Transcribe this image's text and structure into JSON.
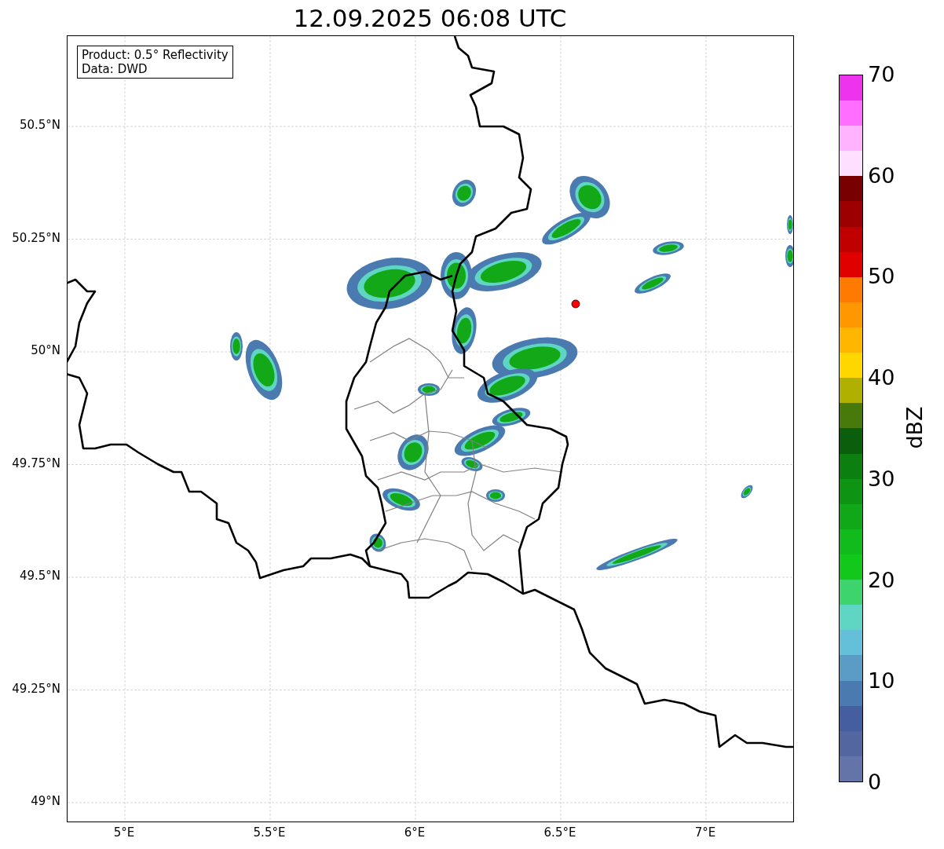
{
  "title": "12.09.2025 06:08 UTC",
  "info_box": [
    "Product: 0.5° Reflectivity",
    "Data: DWD"
  ],
  "map": {
    "lat_labels": [
      "50.5°N",
      "50.25°N",
      "50°N",
      "49.75°N",
      "49.5°N",
      "49.25°N",
      "49°N"
    ],
    "lon_labels": [
      "5°E",
      "5.5°E",
      "6°E",
      "6.5°E",
      "7°E"
    ]
  },
  "colorbar": {
    "label": "dBZ",
    "ticks": [
      "70",
      "60",
      "50",
      "40",
      "30",
      "20",
      "10",
      "0"
    ],
    "bands": [
      {
        "color": "#6574a8"
      },
      {
        "color": "#5466a0"
      },
      {
        "color": "#445ea0"
      },
      {
        "color": "#4a7ab0"
      },
      {
        "color": "#5a9cc6"
      },
      {
        "color": "#64c0d9"
      },
      {
        "color": "#5fd6c3"
      },
      {
        "color": "#3dd46e"
      },
      {
        "color": "#12c81a"
      },
      {
        "color": "#12bb1c"
      },
      {
        "color": "#10a818"
      },
      {
        "color": "#0e9313"
      },
      {
        "color": "#0c7f11"
      },
      {
        "color": "#0a5e0c"
      },
      {
        "color": "#477a0a"
      },
      {
        "color": "#afb000"
      },
      {
        "color": "#ffd700"
      },
      {
        "color": "#ffb600"
      },
      {
        "color": "#ff9800"
      },
      {
        "color": "#ff7a00"
      },
      {
        "color": "#e00000"
      },
      {
        "color": "#c00000"
      },
      {
        "color": "#9c0000"
      },
      {
        "color": "#780000"
      },
      {
        "color": "#ffdfff"
      },
      {
        "color": "#ffb3ff"
      },
      {
        "color": "#ff6eff"
      },
      {
        "color": "#ee33ee"
      }
    ]
  }
}
